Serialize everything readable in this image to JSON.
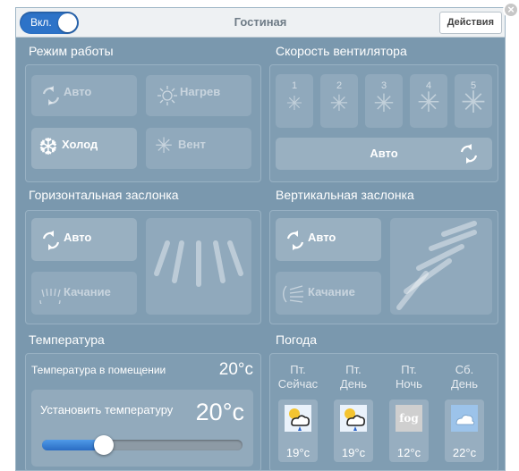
{
  "header": {
    "toggle_label": "Вкл.",
    "room": "Гостиная",
    "actions": "Действия",
    "close_glyph": "×"
  },
  "mode": {
    "title": "Режим работы",
    "items": [
      {
        "label": "Авто",
        "icon": "auto-cycle-icon",
        "active": false
      },
      {
        "label": "Нагрев",
        "icon": "sun-icon",
        "active": false
      },
      {
        "label": "Холод",
        "icon": "snowflake-icon",
        "active": true
      },
      {
        "label": "Вент",
        "icon": "fan-icon",
        "active": false
      }
    ]
  },
  "fan": {
    "title": "Скорость вентилятора",
    "speeds": [
      "1",
      "2",
      "3",
      "4",
      "5"
    ],
    "auto_label": "Авто"
  },
  "hflap": {
    "title": "Горизонтальная заслонка",
    "auto_label": "Авто",
    "swing_label": "Качание"
  },
  "vflap": {
    "title": "Вертикальная заслонка",
    "auto_label": "Авто",
    "swing_label": "Качание"
  },
  "temperature": {
    "title": "Температура",
    "room_label": "Температура в помещении",
    "room_value": "20°c",
    "set_label": "Установить температуру",
    "set_value": "20°c",
    "slider_position": 0.31
  },
  "weather": {
    "title": "Погода",
    "days": [
      {
        "day": "Пт.",
        "period": "Сейчас",
        "temp": "19°c",
        "icon": "sun-cloud-rain-icon"
      },
      {
        "day": "Пт.",
        "period": "День",
        "temp": "19°c",
        "icon": "sun-cloud-rain-icon"
      },
      {
        "day": "Пт.",
        "period": "Ночь",
        "temp": "12°c",
        "icon": "fog-icon",
        "icon_text": "fog"
      },
      {
        "day": "Сб.",
        "period": "День",
        "temp": "22°c",
        "icon": "cloud-icon"
      }
    ]
  },
  "colors": {
    "accent": "#2d73c8",
    "panel": "#7a98ae"
  }
}
